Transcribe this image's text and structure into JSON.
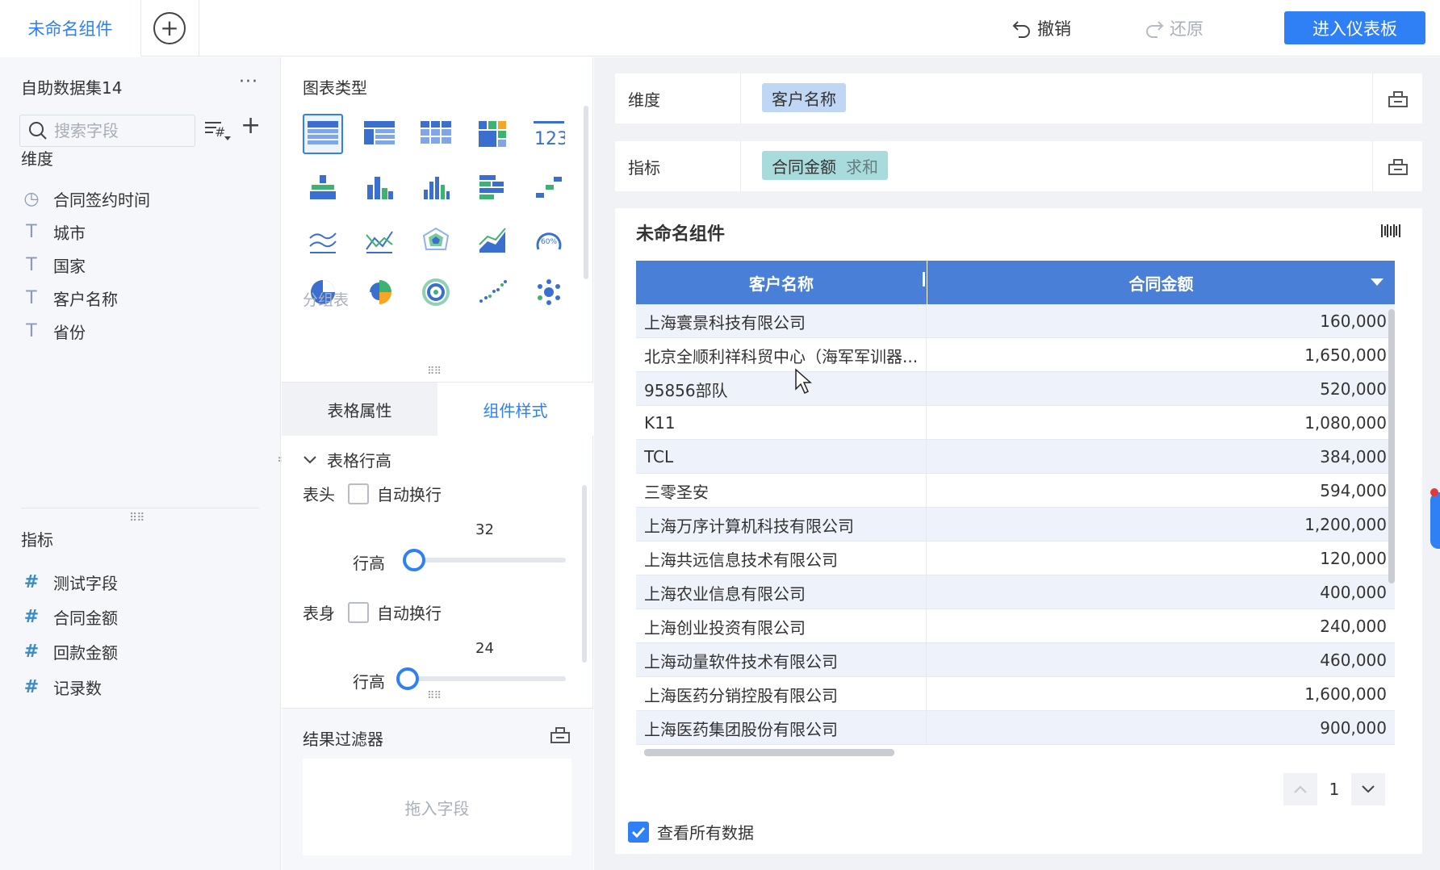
{
  "topbar": {
    "active_tab": "未命名组件",
    "undo_label": "撤销",
    "redo_label": "还原",
    "enter_dashboard_label": "进入仪表板"
  },
  "left": {
    "dataset_title": "自助数据集14",
    "more": "···",
    "search_placeholder": "搜索字段",
    "dimension_title": "维度",
    "dimensions": [
      {
        "label": "合同签约时间",
        "icon": "clock-icon",
        "glyph": "◷"
      },
      {
        "label": "城市",
        "icon": "text-type-icon",
        "glyph": "T"
      },
      {
        "label": "国家",
        "icon": "text-type-icon",
        "glyph": "T"
      },
      {
        "label": "客户名称",
        "icon": "text-type-icon",
        "glyph": "T"
      },
      {
        "label": "省份",
        "icon": "text-type-icon",
        "glyph": "T"
      }
    ],
    "measure_title": "指标",
    "measures": [
      {
        "label": "测试字段",
        "icon": "number-type-icon",
        "glyph": "#"
      },
      {
        "label": "合同金额",
        "icon": "number-type-icon",
        "glyph": "#"
      },
      {
        "label": "回款金额",
        "icon": "number-type-icon",
        "glyph": "#"
      },
      {
        "label": "记录数",
        "icon": "number-type-icon",
        "glyph": "#"
      }
    ]
  },
  "middle": {
    "chart_type_title": "图表类型",
    "group_label": "分组表",
    "tab_table_props": "表格属性",
    "tab_component_style": "组件样式",
    "row_height_section": "表格行高",
    "header_label": "表头",
    "body_label": "表身",
    "auto_wrap": "自动换行",
    "row_height_label": "行高",
    "header_row_height": "32",
    "body_row_height": "24",
    "header_slider_fraction": 0.0,
    "body_slider_fraction": 0.0,
    "result_filter_title": "结果过滤器",
    "drop_field_hint": "拖入字段"
  },
  "right": {
    "dimension_shelf_label": "维度",
    "dimension_pill": "客户名称",
    "measure_shelf_label": "指标",
    "measure_pill": "合同金额",
    "measure_agg": "求和",
    "widget_title": "未命名组件",
    "table": {
      "columns": [
        "客户名称",
        "合同金额"
      ],
      "rows": [
        [
          "上海寰景科技有限公司",
          "160,000"
        ],
        [
          "北京全顺利祥科贸中心（海军军训器...",
          "1,650,000"
        ],
        [
          "95856部队",
          "520,000"
        ],
        [
          "K11",
          "1,080,000"
        ],
        [
          "TCL",
          "384,000"
        ],
        [
          "三零圣安",
          "594,000"
        ],
        [
          "上海万序计算机科技有限公司",
          "1,200,000"
        ],
        [
          "上海共远信息技术有限公司",
          "120,000"
        ],
        [
          "上海农业信息有限公司",
          "400,000"
        ],
        [
          "上海创业投资有限公司",
          "240,000"
        ],
        [
          "上海动量软件技术有限公司",
          "460,000"
        ],
        [
          "上海医药分销控股有限公司",
          "1,600,000"
        ],
        [
          "上海医药集团股份有限公司",
          "900,000"
        ]
      ]
    },
    "page_number": "1",
    "view_all_label": "查看所有数据"
  },
  "colors": {
    "accent": "#2f7ff5",
    "table_header": "#4a7fd8",
    "dimension_pill": "#c0d6f5",
    "measure_pill": "#a8dbdc"
  }
}
